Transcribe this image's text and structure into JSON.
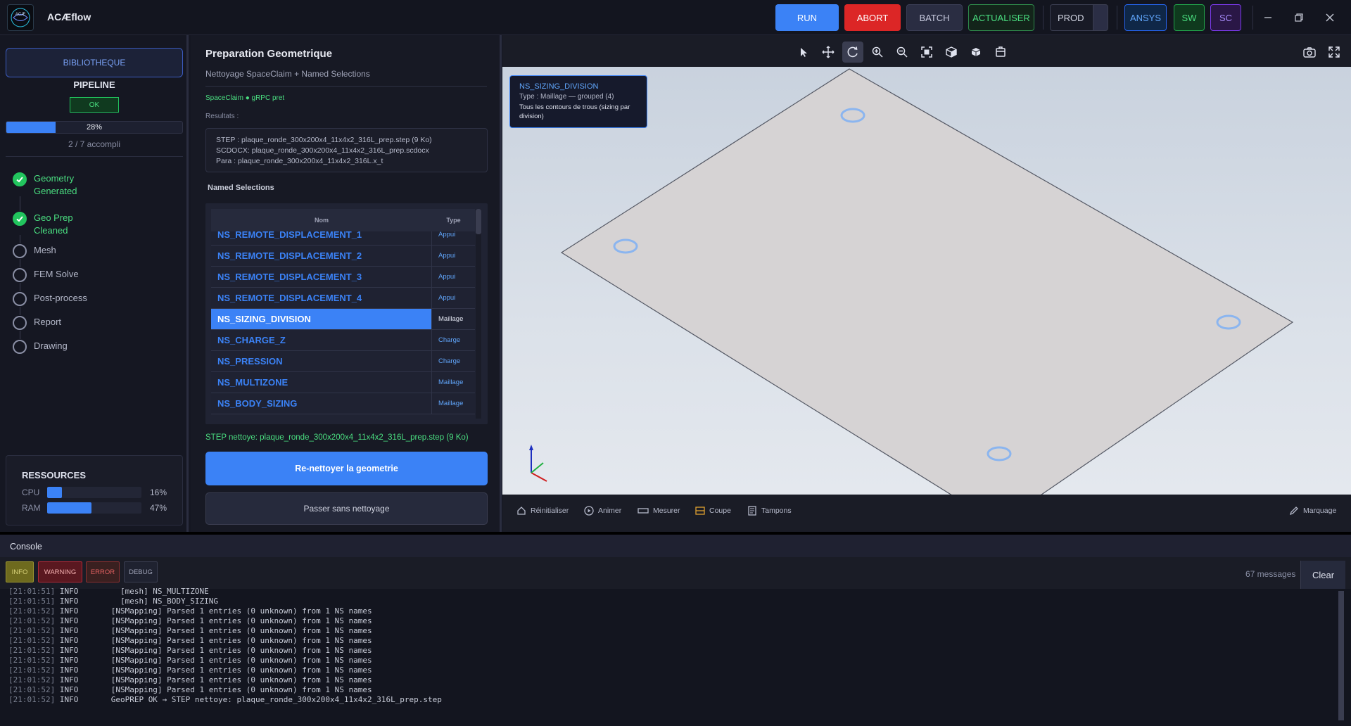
{
  "app": {
    "title": "ACÆflow",
    "logo_text": "ACÆ"
  },
  "toolbar": {
    "run": "RUN",
    "abort": "ABORT",
    "batch": "BATCH",
    "actualiser": "ACTUALISER",
    "environment": "PROD",
    "ansys": "ANSYS",
    "sw": "SW",
    "sc": "SC"
  },
  "sidebar": {
    "library_button": "BIBLIOTHEQUE",
    "pipeline_title": "PIPELINE",
    "pipeline_status": "OK",
    "progress": {
      "percent": 28,
      "label": "28%",
      "count_text": "2 / 7 accompli"
    },
    "steps": [
      {
        "label": "Geometry Generated",
        "done": true
      },
      {
        "label": "Geo Prep Cleaned",
        "done": true
      },
      {
        "label": "Mesh",
        "done": false
      },
      {
        "label": "FEM Solve",
        "done": false
      },
      {
        "label": "Post-process",
        "done": false
      },
      {
        "label": "Report",
        "done": false
      },
      {
        "label": "Drawing",
        "done": false
      }
    ],
    "resources": {
      "title": "RESSOURCES",
      "cpu": {
        "label": "CPU",
        "percent": 16,
        "text": "16%"
      },
      "ram": {
        "label": "RAM",
        "percent": 47,
        "text": "47%"
      }
    }
  },
  "panel": {
    "title": "Preparation Geometrique",
    "subtitle": "Nettoyage SpaceClaim + Named Selections",
    "connection_status": "SpaceClaim ● gRPC pret",
    "results_label": "Resultats :",
    "results": [
      "STEP  : plaque_ronde_300x200x4_11x4x2_316L_prep.step (9 Ko)",
      "SCDOCX: plaque_ronde_300x200x4_11x4x2_316L_prep.scdocx",
      "Para  : plaque_ronde_300x200x4_11x4x2_316L.x_t"
    ],
    "named_selections_label": "Named Selections",
    "table_headers": {
      "name": "Nom",
      "type": "Type"
    },
    "named_selections": [
      {
        "name": "NS_REMOTE_DISPLACEMENT_1",
        "type": "Appui",
        "selected": false
      },
      {
        "name": "NS_REMOTE_DISPLACEMENT_2",
        "type": "Appui",
        "selected": false
      },
      {
        "name": "NS_REMOTE_DISPLACEMENT_3",
        "type": "Appui",
        "selected": false
      },
      {
        "name": "NS_REMOTE_DISPLACEMENT_4",
        "type": "Appui",
        "selected": false
      },
      {
        "name": "NS_SIZING_DIVISION",
        "type": "Maillage",
        "selected": true
      },
      {
        "name": "NS_CHARGE_Z",
        "type": "Charge",
        "selected": false
      },
      {
        "name": "NS_PRESSION",
        "type": "Charge",
        "selected": false
      },
      {
        "name": "NS_MULTIZONE",
        "type": "Maillage",
        "selected": false
      },
      {
        "name": "NS_BODY_SIZING",
        "type": "Maillage",
        "selected": false
      }
    ],
    "step_status": "STEP nettoye: plaque_ronde_300x200x4_11x4x2_316L_prep.step (9 Ko)",
    "renettoyer_button": "Re-nettoyer la geometrie",
    "passer_button": "Passer sans nettoyage"
  },
  "viewport": {
    "tooltip": {
      "title": "NS_SIZING_DIVISION",
      "type": "Type : Maillage — grouped (4)",
      "description": "Tous les contours de trous (sizing par division)"
    },
    "tools": [
      "select-icon",
      "pan-icon",
      "rotate-icon",
      "zoom-in-icon",
      "zoom-out-icon",
      "fit-icon",
      "iso-view-icon",
      "box-view-icon",
      "section-box-icon"
    ],
    "active_tool": "rotate-icon",
    "actions": {
      "reset": "Réinitialiser",
      "animate": "Animer",
      "measure": "Mesurer",
      "section": "Coupe",
      "stamps": "Tampons",
      "marking": "Marquage"
    }
  },
  "console": {
    "title": "Console",
    "filters": {
      "info": "INFO",
      "warning": "WARNING",
      "error": "ERROR",
      "debug": "DEBUG"
    },
    "message_count": "67 messages",
    "clear_button": "Clear",
    "lines": [
      {
        "ts": "[21:01:51]",
        "level": "INFO",
        "msg": "      [mesh] NS_MULTIZONE"
      },
      {
        "ts": "[21:01:51]",
        "level": "INFO",
        "msg": "      [mesh] NS_BODY_SIZING"
      },
      {
        "ts": "[21:01:52]",
        "level": "INFO",
        "msg": "    [NSMapping] Parsed 1 entries (0 unknown) from 1 NS names"
      },
      {
        "ts": "[21:01:52]",
        "level": "INFO",
        "msg": "    [NSMapping] Parsed 1 entries (0 unknown) from 1 NS names"
      },
      {
        "ts": "[21:01:52]",
        "level": "INFO",
        "msg": "    [NSMapping] Parsed 1 entries (0 unknown) from 1 NS names"
      },
      {
        "ts": "[21:01:52]",
        "level": "INFO",
        "msg": "    [NSMapping] Parsed 1 entries (0 unknown) from 1 NS names"
      },
      {
        "ts": "[21:01:52]",
        "level": "INFO",
        "msg": "    [NSMapping] Parsed 1 entries (0 unknown) from 1 NS names"
      },
      {
        "ts": "[21:01:52]",
        "level": "INFO",
        "msg": "    [NSMapping] Parsed 1 entries (0 unknown) from 1 NS names"
      },
      {
        "ts": "[21:01:52]",
        "level": "INFO",
        "msg": "    [NSMapping] Parsed 1 entries (0 unknown) from 1 NS names"
      },
      {
        "ts": "[21:01:52]",
        "level": "INFO",
        "msg": "    [NSMapping] Parsed 1 entries (0 unknown) from 1 NS names"
      },
      {
        "ts": "[21:01:52]",
        "level": "INFO",
        "msg": "    [NSMapping] Parsed 1 entries (0 unknown) from 1 NS names"
      },
      {
        "ts": "[21:01:52]",
        "level": "INFO",
        "msg": "    GeoPREP OK → STEP nettoye: plaque_ronde_300x200x4_11x4x2_316L_prep.step"
      }
    ]
  },
  "colors": {
    "accent": "#3b82f6",
    "success": "#22c55e",
    "danger": "#dc2626",
    "viewport_bg": "#dbe1e9"
  }
}
